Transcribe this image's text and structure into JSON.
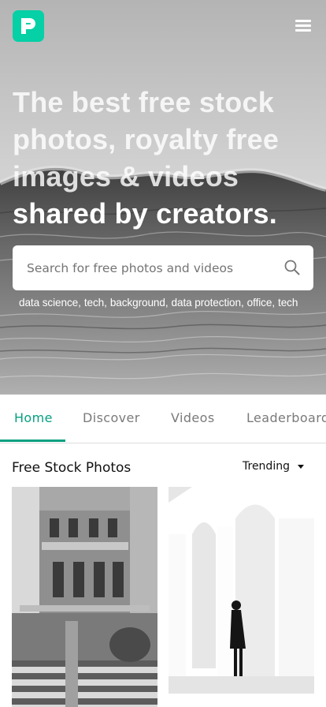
{
  "header": {
    "logo_icon": "pexels-logo-icon",
    "brand_color": "#05d0a6",
    "menu_icon": "hamburger-menu-icon"
  },
  "hero": {
    "headline_line1": "The best free stock photos, royalty free images & videos",
    "headline_line2": "shared by creators.",
    "search": {
      "placeholder": "Search for free photos and videos",
      "value": "",
      "icon": "search-icon"
    },
    "tags": [
      "data science",
      "tech",
      "background",
      "data protection",
      "office",
      "tech"
    ]
  },
  "tabs": {
    "items": [
      {
        "label": "Home",
        "active": true
      },
      {
        "label": "Discover",
        "active": false
      },
      {
        "label": "Videos",
        "active": false
      },
      {
        "label": "Leaderboard",
        "active": false
      }
    ],
    "active_color": "#05a081"
  },
  "section": {
    "title": "Free Stock Photos",
    "sort_label": "Trending",
    "sort_icon": "caret-down-icon"
  },
  "photos": [
    {
      "subject": "building-photo"
    },
    {
      "subject": "arches-photo"
    }
  ]
}
